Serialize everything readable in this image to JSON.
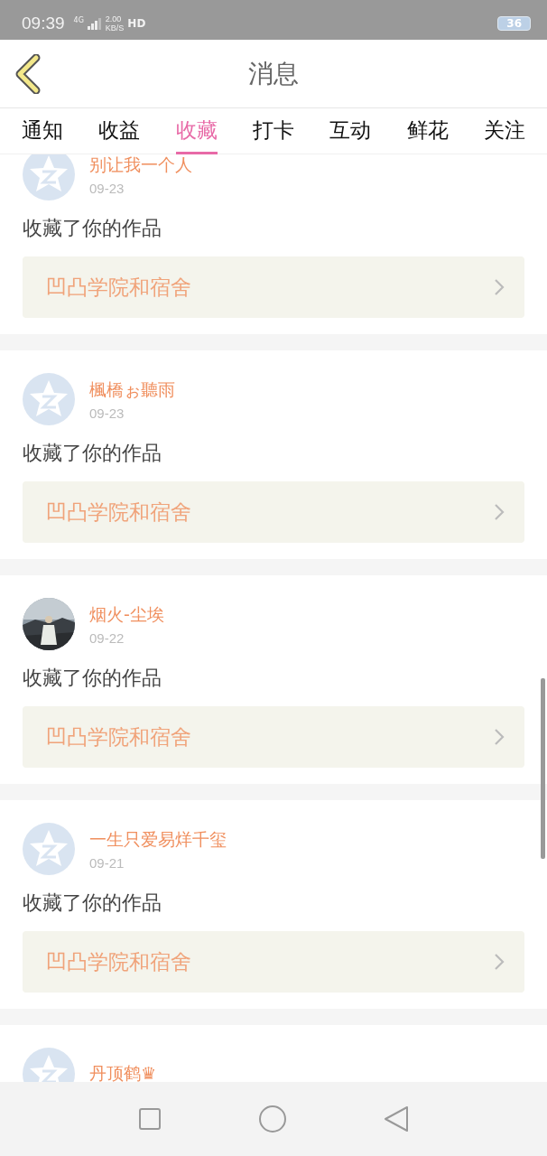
{
  "status_bar": {
    "time": "09:39",
    "network": "4G",
    "speed": "2.00",
    "speed_unit": "KB/S",
    "hd": "HD",
    "battery": "36"
  },
  "header": {
    "title": "消息"
  },
  "tabs": [
    {
      "label": "通知",
      "selected": false
    },
    {
      "label": "收益",
      "selected": false
    },
    {
      "label": "收藏",
      "selected": true
    },
    {
      "label": "打卡",
      "selected": false
    },
    {
      "label": "互动",
      "selected": false
    },
    {
      "label": "鲜花",
      "selected": false
    },
    {
      "label": "关注",
      "selected": false
    }
  ],
  "messages": [
    {
      "name": "别让我一个人",
      "date": "09-23",
      "kind": "default",
      "action": "收藏了你的作品",
      "work": "凹凸学院和宿舍"
    },
    {
      "name": "楓橋ぉ聽雨",
      "date": "09-23",
      "kind": "default",
      "action": "收藏了你的作品",
      "work": "凹凸学院和宿舍"
    },
    {
      "name": "烟火-尘埃",
      "date": "09-22",
      "kind": "picture",
      "action": "收藏了你的作品",
      "work": "凹凸学院和宿舍"
    },
    {
      "name": "一生只爱易烊千玺",
      "date": "09-21",
      "kind": "default",
      "action": "收藏了你的作品",
      "work": "凹凸学院和宿舍"
    },
    {
      "name": "丹顶鹤♛",
      "kind": "default"
    }
  ]
}
